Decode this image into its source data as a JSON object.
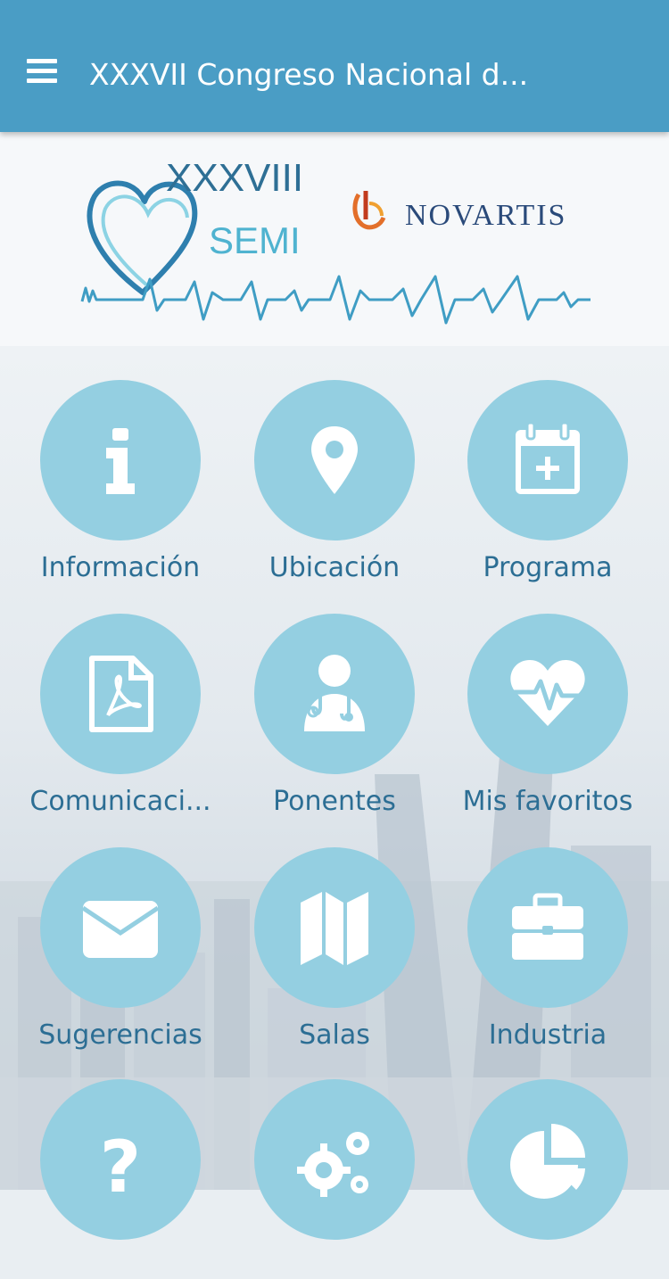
{
  "appbar": {
    "title": "XXXVII Congreso Nacional d..."
  },
  "banner": {
    "event_roman": "XXXVIII",
    "event_org": "SEMI",
    "sponsor": "NOVARTIS"
  },
  "colors": {
    "appbar": "#4a9dc5",
    "circle": "#94cfe1",
    "label": "#2c6e94"
  },
  "grid": {
    "items": [
      {
        "label": "Información",
        "icon": "info-icon"
      },
      {
        "label": "Ubicación",
        "icon": "location-pin-icon"
      },
      {
        "label": "Programa",
        "icon": "calendar-add-icon"
      },
      {
        "label": "Comunicaci...",
        "icon": "pdf-document-icon"
      },
      {
        "label": "Ponentes",
        "icon": "doctor-icon"
      },
      {
        "label": "Mis favoritos",
        "icon": "heart-pulse-icon"
      },
      {
        "label": "Sugerencias",
        "icon": "envelope-icon"
      },
      {
        "label": "Salas",
        "icon": "map-icon"
      },
      {
        "label": "Industria",
        "icon": "briefcase-icon"
      },
      {
        "label": "",
        "icon": "question-icon"
      },
      {
        "label": "",
        "icon": "gears-icon"
      },
      {
        "label": "",
        "icon": "pie-chart-icon"
      }
    ]
  }
}
